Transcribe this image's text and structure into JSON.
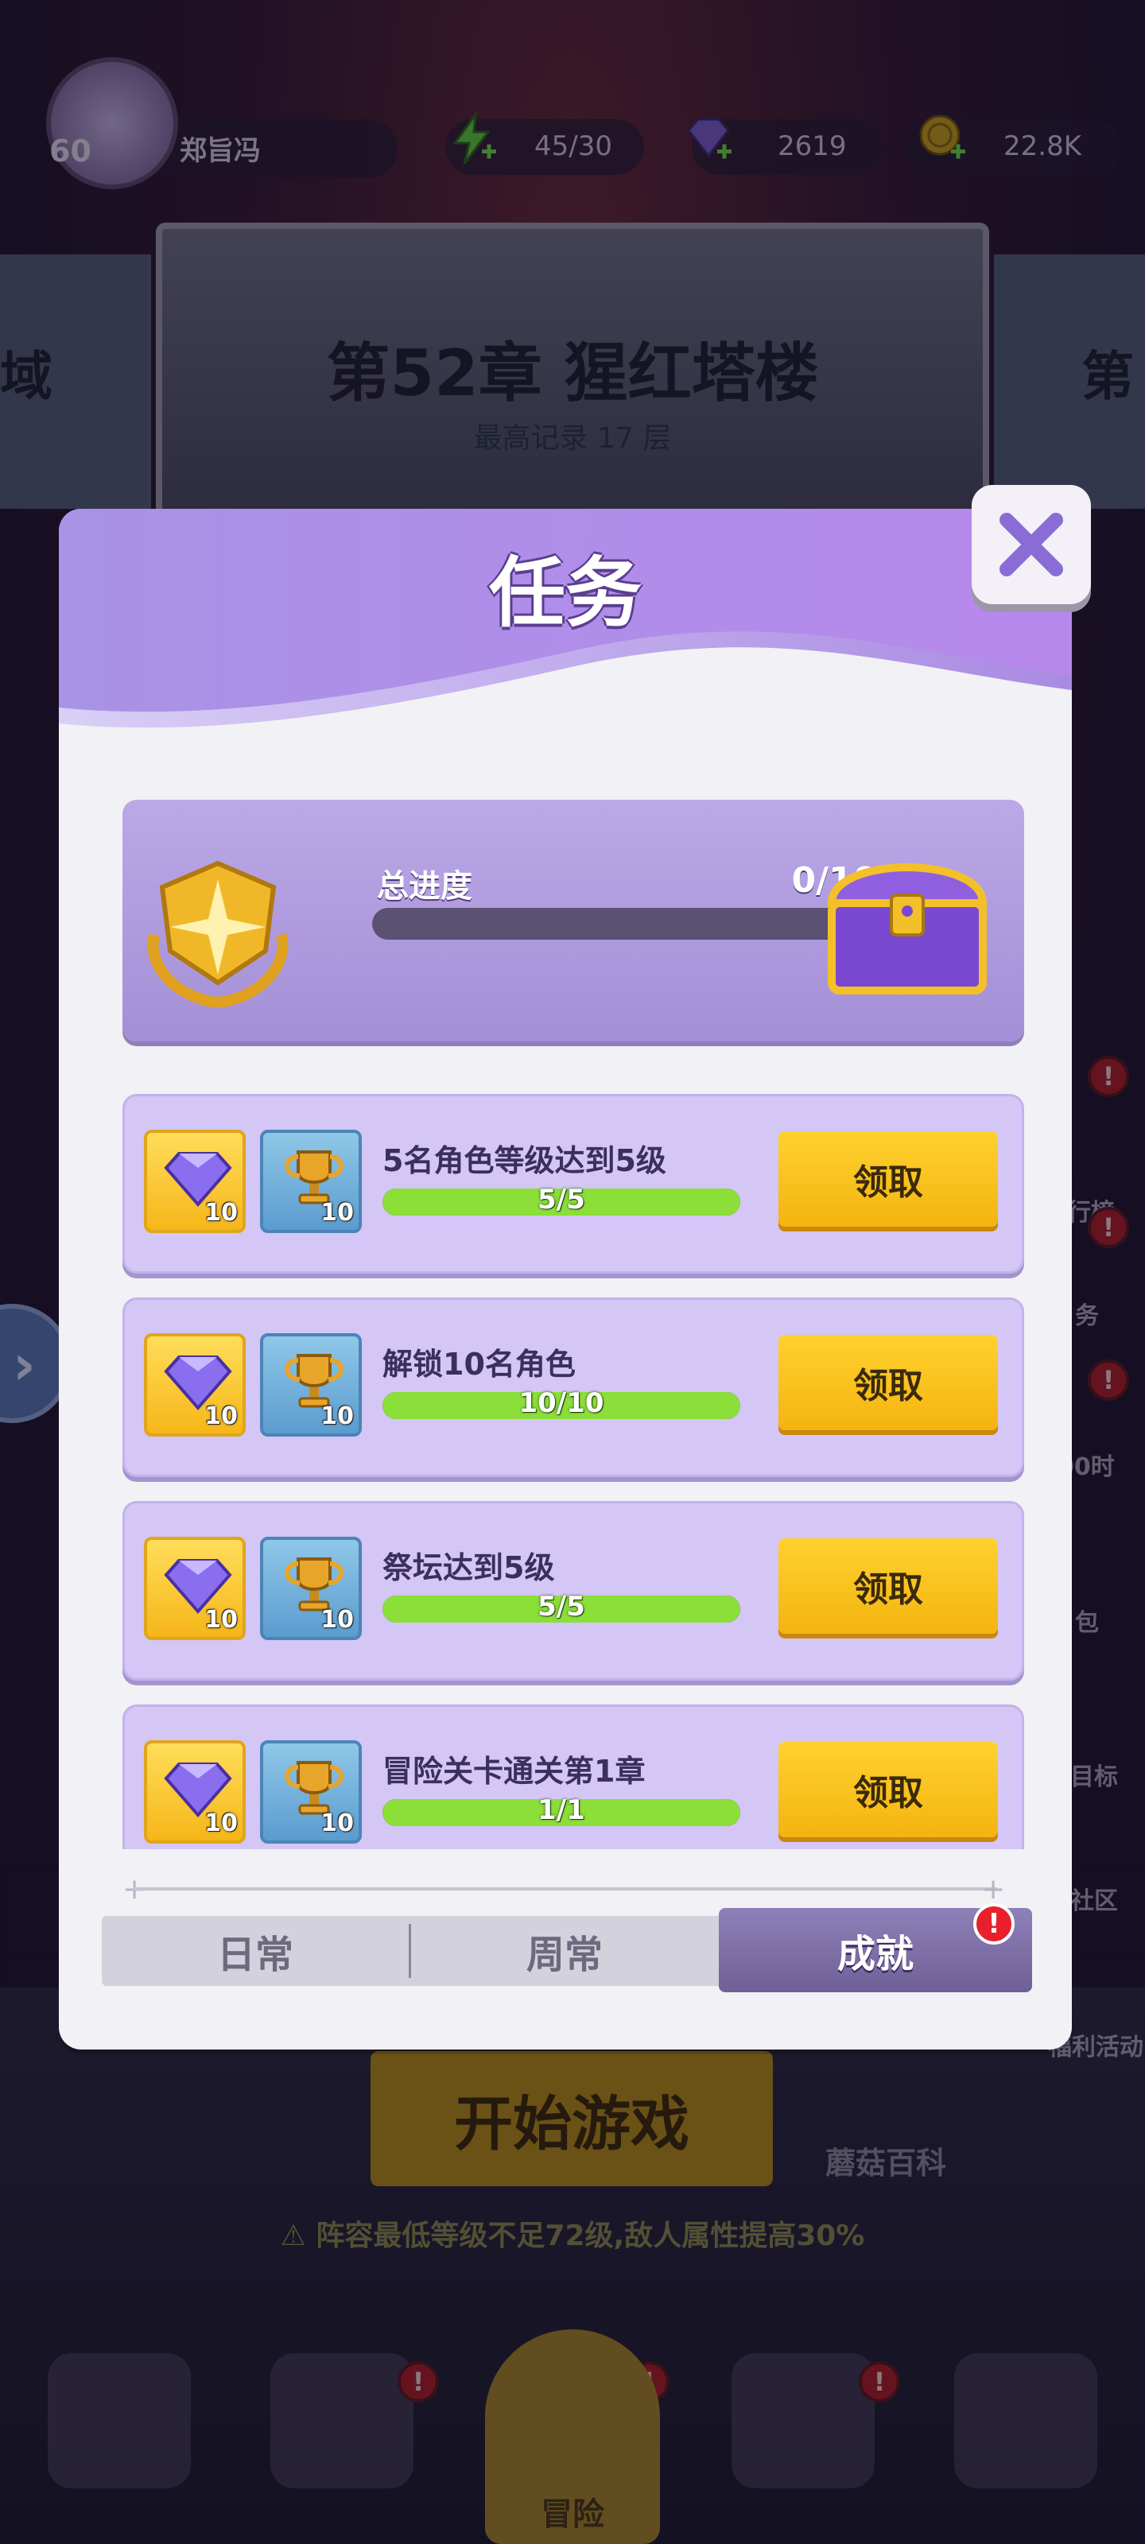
{
  "player": {
    "level": "60",
    "name": "郑旨冯"
  },
  "resources": {
    "energy": "45/30",
    "gems": "2619",
    "coins": "22.8K"
  },
  "chapter": {
    "title": "第52章 猩红塔楼",
    "subtitle": "最高记录 17 层",
    "left_side": "域",
    "right_side": "第"
  },
  "modal": {
    "title": "任务",
    "close_label": "×",
    "overall": {
      "label": "总进度",
      "value": "0/100",
      "progress": 0
    },
    "tasks": [
      {
        "title": "5名角色等级达到5级",
        "progress_text": "5/5",
        "progress": 1.0,
        "rewards": [
          "10",
          "10"
        ],
        "button": "领取"
      },
      {
        "title": "解锁10名角色",
        "progress_text": "10/10",
        "progress": 1.0,
        "rewards": [
          "10",
          "10"
        ],
        "button": "领取"
      },
      {
        "title": "祭坛达到5级",
        "progress_text": "5/5",
        "progress": 1.0,
        "rewards": [
          "10",
          "10"
        ],
        "button": "领取"
      },
      {
        "title": "冒险关卡通关第1章",
        "progress_text": "1/1",
        "progress": 1.0,
        "rewards": [
          "10",
          "10"
        ],
        "button": "领取"
      }
    ],
    "tabs": [
      {
        "label": "日常",
        "active": false
      },
      {
        "label": "周常",
        "active": false
      },
      {
        "label": "成就",
        "active": true
      }
    ],
    "tab_badge": "!"
  },
  "background": {
    "start_button": "开始游戏",
    "warning": "阵容最低等级不足72级,敌人属性提高30%",
    "mushroom_wiki": "蘑菇百科",
    "right_menu": [
      "行榜",
      "务",
      "00时",
      "包",
      "目标",
      "社区",
      "福利活动"
    ],
    "nav_center": "冒险"
  },
  "colors": {
    "accent_purple": "#8e80b8",
    "claim_yellow": "#ffd12e",
    "progress_green": "#8bdf38",
    "badge_red": "#e8202b"
  }
}
